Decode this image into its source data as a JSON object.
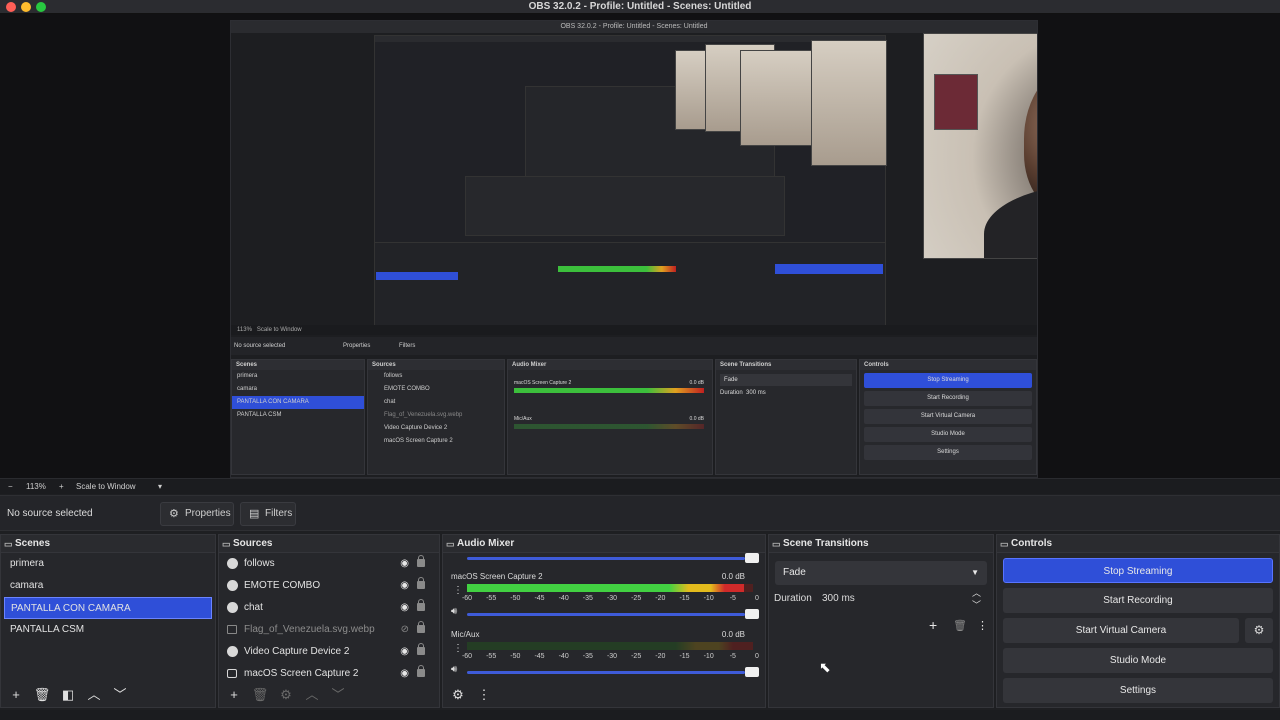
{
  "window": {
    "title": "OBS 32.0.2 - Profile: Untitled - Scenes: Untitled",
    "traffic_lights": [
      "#ff5f57",
      "#febc2e",
      "#28c840"
    ]
  },
  "nested_preview": {
    "title": "OBS 32.0.2 - Profile: Untitled - Scenes: Untitled",
    "context_label": "No source selected",
    "properties": "Properties",
    "filters": "Filters",
    "zoom": "113%",
    "scale_mode": "Scale to Window",
    "scenes_header": "Scenes",
    "scenes": [
      "primera",
      "camara",
      "PANTALLA CON CAMARA",
      "PANTALLA CSM"
    ],
    "sources_header": "Sources",
    "sources": [
      "follows",
      "EMOTE COMBO",
      "chat",
      "Flag_of_Venezuela.svg.webp",
      "Video Capture Device 2",
      "macOS Screen Capture 2"
    ],
    "mixer_header": "Audio Mixer",
    "mixer_ch1": "macOS Screen Capture 2",
    "mixer_ch1_db": "0.0 dB",
    "mixer_ch2": "Mic/Aux",
    "mixer_ch2_db": "0.0 dB",
    "transitions_header": "Scene Transitions",
    "transition": "Fade",
    "duration_label": "Duration",
    "duration": "300 ms",
    "controls_header": "Controls",
    "controls": [
      "Stop Streaming",
      "Start Recording",
      "Start Virtual Camera",
      "Studio Mode",
      "Settings"
    ]
  },
  "zoom_bar": {
    "minus": "−",
    "zoom": "113%",
    "plus": "+",
    "scale_mode": "Scale to Window",
    "caret": "▾"
  },
  "context_bar": {
    "label": "No source selected",
    "properties": "Properties",
    "filters": "Filters"
  },
  "scenes": {
    "header": "Scenes",
    "items": [
      "primera",
      "camara",
      "PANTALLA CON CAMARA",
      "PANTALLA CSM"
    ],
    "selected_index": 2
  },
  "sources": {
    "header": "Sources",
    "items": [
      {
        "name": "follows",
        "icon": "globe-icon",
        "visible": true
      },
      {
        "name": "EMOTE COMBO",
        "icon": "globe-icon",
        "visible": true
      },
      {
        "name": "chat",
        "icon": "globe-icon",
        "visible": true
      },
      {
        "name": "Flag_of_Venezuela.svg.webp",
        "icon": "image-icon",
        "visible": false
      },
      {
        "name": "Video Capture Device 2",
        "icon": "camera-icon",
        "visible": true
      },
      {
        "name": "macOS Screen Capture 2",
        "icon": "monitor-icon",
        "visible": true
      }
    ]
  },
  "audio_mixer": {
    "header": "Audio Mixer",
    "channels": [
      {
        "name": "macOS Screen Capture 2",
        "db": "0.0 dB",
        "level": 0.97
      },
      {
        "name": "Mic/Aux",
        "db": "0.0 dB",
        "level": 0.0
      }
    ],
    "ticks": [
      "-60",
      "-55",
      "-50",
      "-45",
      "-40",
      "-35",
      "-30",
      "-25",
      "-20",
      "-15",
      "-10",
      "-5",
      "0"
    ]
  },
  "scene_transitions": {
    "header": "Scene Transitions",
    "transition": "Fade",
    "duration_label": "Duration",
    "duration": "300 ms"
  },
  "controls": {
    "header": "Controls",
    "stop_streaming": "Stop Streaming",
    "start_recording": "Start Recording",
    "start_virtual_camera": "Start Virtual Camera",
    "studio_mode": "Studio Mode",
    "settings": "Settings",
    "accent": "#2f4fd8"
  }
}
